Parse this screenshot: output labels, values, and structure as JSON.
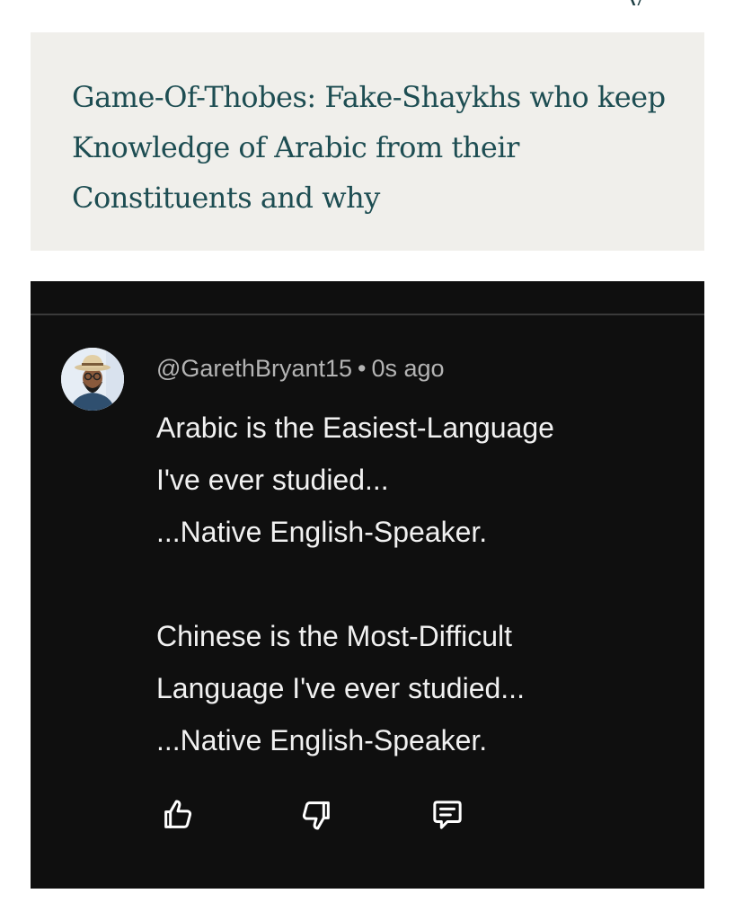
{
  "article": {
    "title": "Game-Of-Thobes: Fake-Shaykhs who keep Knowledge of Arabic from their Constituents and why"
  },
  "comment": {
    "author": "@GarethBryant15",
    "separator": "•",
    "timestamp": "0s ago",
    "body": [
      "Arabic is the Easiest-Language",
      "I've ever studied...",
      "...Native English-Speaker.",
      "",
      "Chinese is the Most-Difficult",
      "Language I've ever studied...",
      "...Native English-Speaker."
    ],
    "actions": {
      "like_icon": "thumbs-up-icon",
      "dislike_icon": "thumbs-down-icon",
      "reply_icon": "comment-icon"
    }
  },
  "colors": {
    "article_background": "#f0efeb",
    "article_title": "#1d4d52",
    "comment_background": "#0f0f0f",
    "comment_text": "#f1f1f1",
    "meta_text": "#b4b4b4"
  }
}
